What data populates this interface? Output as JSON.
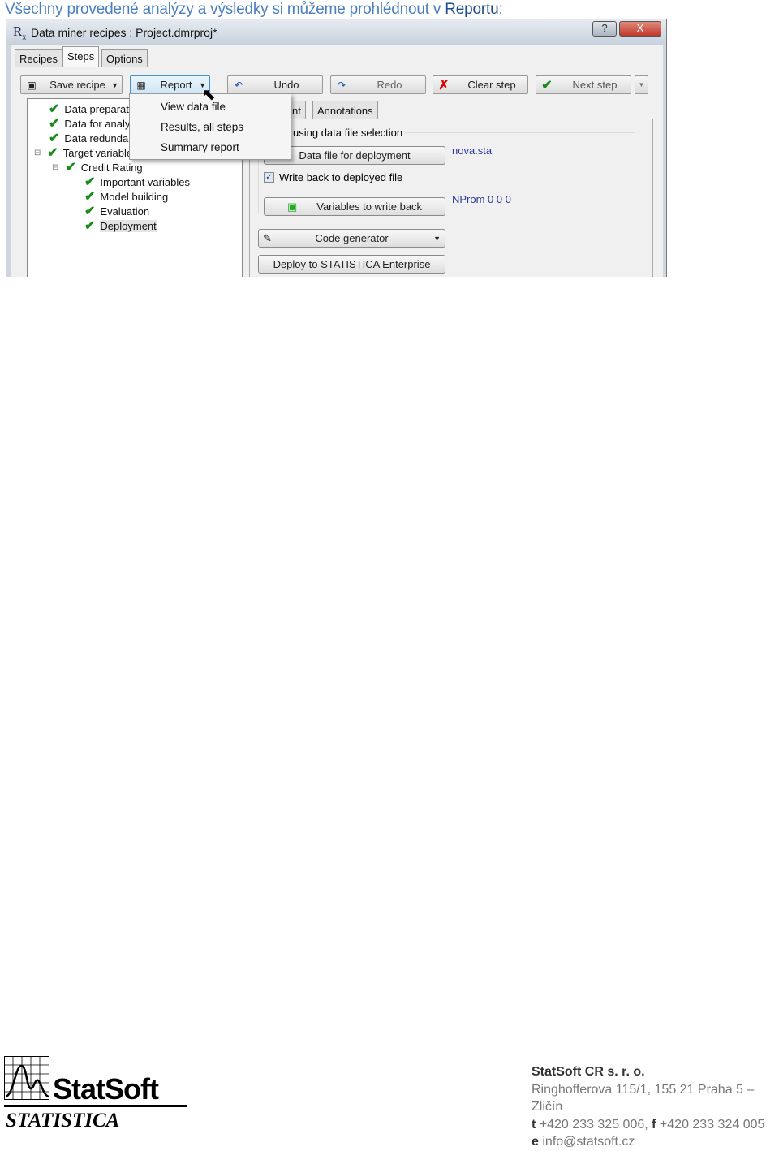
{
  "intro": {
    "text": "Všechny provedené analýzy a výsledky si můžeme prohlédnout v ",
    "highlight": "Reportu",
    "suffix": ":"
  },
  "window": {
    "title": "Data miner recipes : Project.dmrproj*",
    "help": "?",
    "close": "X"
  },
  "tabs": [
    {
      "label": "Recipes"
    },
    {
      "label": "Steps",
      "selected": true
    },
    {
      "label": "Options"
    }
  ],
  "toolbar": {
    "save": "Save recipe",
    "report": "Report",
    "undo": "Undo",
    "redo": "Redo",
    "clear": "Clear step",
    "next": "Next step"
  },
  "menu": [
    "View data file",
    "Results, all steps",
    "Summary report"
  ],
  "tree": [
    {
      "label": "Data preparation",
      "level": 0
    },
    {
      "label": "Data for analysis",
      "level": 0
    },
    {
      "label": "Data redundancy",
      "level": 0
    },
    {
      "label": "Target variable",
      "level": 0,
      "expanded": true
    },
    {
      "label": "Credit Rating",
      "level": 1
    },
    {
      "label": "Important variables",
      "level": 2
    },
    {
      "label": "Model building",
      "level": 2
    },
    {
      "label": "Evaluation",
      "level": 2
    },
    {
      "label": "Deployment",
      "level": 2,
      "selected": true
    }
  ],
  "subtabs": [
    "nt",
    "Annotations"
  ],
  "deploy": {
    "group_label": "using data file selection",
    "data_file_button": "Data file for deployment",
    "data_file_value": "nova.sta",
    "write_back_label": "Write back to deployed file",
    "write_back_checked": true,
    "variables_button": "Variables to write back",
    "variables_value": "NProm 0 0 0",
    "code_generator": "Code generator",
    "deploy_enterprise": "Deploy to STATISTICA Enterprise"
  },
  "footer": {
    "logo_brand": "StatSoft",
    "logo_product": "STATISTICA",
    "company": "StatSoft CR s. r. o.",
    "address": "Ringhofferova 115/1, 155 21 Praha 5 – Zličín",
    "phone_label": "t",
    "phone": "+420 233 325 006,",
    "fax_label": "f",
    "fax": "+420 233 324 005",
    "email_label": "e",
    "email": "info@statsoft.cz"
  }
}
